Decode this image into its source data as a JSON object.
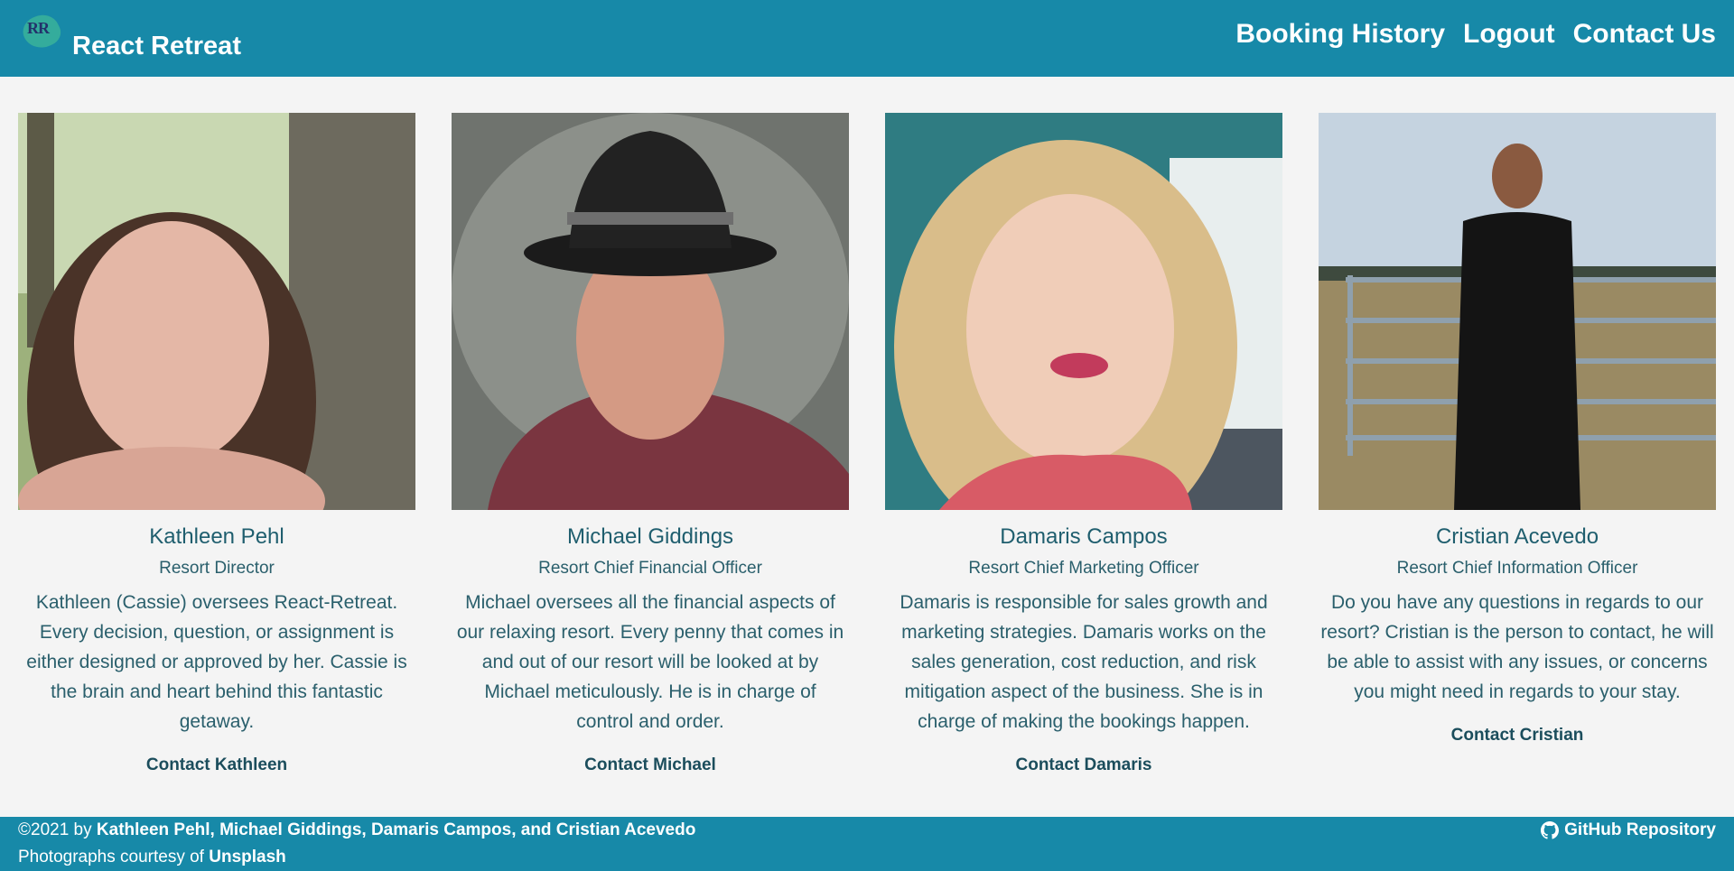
{
  "header": {
    "logo_text": "RR",
    "site_title": "React Retreat",
    "nav": [
      "Booking History",
      "Logout",
      "Contact Us"
    ]
  },
  "team": [
    {
      "name": "Kathleen Pehl",
      "role": "Resort Director",
      "bio": "Kathleen (Cassie) oversees React-Retreat. Every decision, question, or assignment is either designed or approved by her. Cassie is the brain and heart behind this fantastic getaway.",
      "contact": "Contact Kathleen"
    },
    {
      "name": "Michael Giddings",
      "role": "Resort Chief Financial Officer",
      "bio": "Michael oversees all the financial aspects of our relaxing resort. Every penny that comes in and out of our resort will be looked at by Michael meticulously. He is in charge of control and order.",
      "contact": "Contact Michael"
    },
    {
      "name": "Damaris Campos",
      "role": "Resort Chief Marketing Officer",
      "bio": "Damaris is responsible for sales growth and marketing strategies. Damaris works on the sales generation, cost reduction, and risk mitigation aspect of the business. She is in charge of making the bookings happen.",
      "contact": "Contact Damaris"
    },
    {
      "name": "Cristian Acevedo",
      "role": "Resort Chief Information Officer",
      "bio": "Do you have any questions in regards to our resort? Cristian is the person to contact, he will be able to assist with any issues, or concerns you might need in regards to your stay.",
      "contact": "Contact Cristian"
    }
  ],
  "footer": {
    "copyright_prefix": "©2021 by",
    "authors": "Kathleen Pehl, Michael Giddings, Damaris Campos, and Cristian Acevedo",
    "photos_prefix": "Photographs courtesy of",
    "photos_link": "Unsplash",
    "github_label": "GitHub Repository",
    "github_icon": "github-icon"
  },
  "colors": {
    "header_bg": "#1789a8",
    "page_bg": "#f4f4f4",
    "text": "#1b5b6b"
  }
}
